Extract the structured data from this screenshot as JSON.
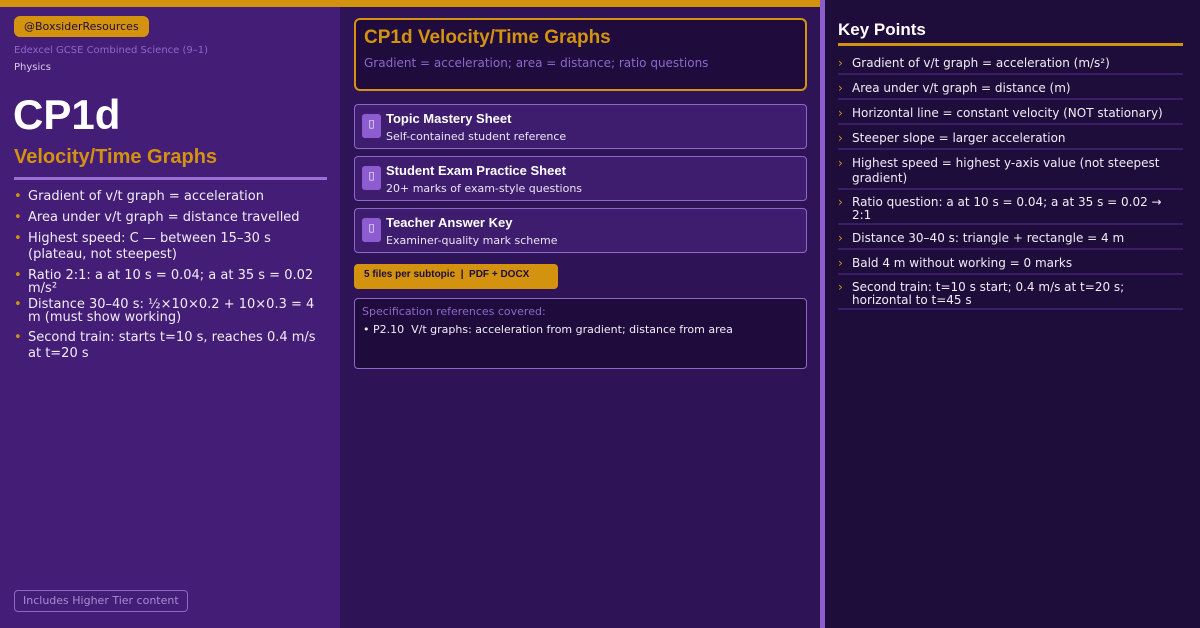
{
  "brand": {
    "handle": "@BoxsiderResources"
  },
  "course": {
    "exam_board": "Edexcel GCSE Combined Science (9–1)",
    "subject": "Physics"
  },
  "topic": {
    "code": "CP1d",
    "title": "Velocity/Time Graphs"
  },
  "summary_points": [
    "Gradient of v/t graph = acceleration",
    "Area under v/t graph = distance travelled",
    "Highest speed: C — between 15–30 s (plateau, not steepest)",
    "Ratio 2:1: a at 10 s = 0.04; a at 35 s = 0.02 m/s²",
    "Distance 30–40 s: ½×10×0.2 + 10×0.3 = 4 m (must show working)",
    "Second train: starts t=10 s, reaches 0.4 m/s at t=20 s"
  ],
  "tier_note": "Includes Higher Tier content",
  "hero": {
    "title": "CP1d Velocity/Time Graphs",
    "subtitle": "Gradient = acceleration; area = distance; ratio questions"
  },
  "files": [
    {
      "icon": "document-icon",
      "title": "Topic Mastery Sheet",
      "description": "Self-contained student reference"
    },
    {
      "icon": "document-icon",
      "title": "Student Exam Practice Sheet",
      "description": "20+ marks of exam-style questions"
    },
    {
      "icon": "document-icon",
      "title": "Teacher Answer Key",
      "description": "Examiner-quality mark scheme"
    }
  ],
  "files_badge": "5 files per subtopic  |  PDF + DOCX",
  "spec": {
    "heading": "Specification references covered:",
    "items": [
      "• P2.10  V/t graphs: acceleration from gradient; distance from area"
    ]
  },
  "key_points": {
    "title": "Key Points",
    "items": [
      "Gradient of v/t graph = acceleration (m/s²)",
      "Area under v/t graph = distance (m)",
      "Horizontal line = constant velocity (NOT stationary)",
      "Steeper slope = larger acceleration",
      "Highest speed = highest y-axis value (not steepest gradient)",
      "Ratio question: a at 10 s = 0.04; a at 35 s = 0.02 → 2:1",
      "Distance 30–40 s: triangle + rectangle = 4 m",
      "Bald 4 m without working = 0 marks",
      "Second train: t=10 s start; 0.4 m/s at t=20 s; horizontal to t=45 s"
    ]
  },
  "colors": {
    "accent": "#d4930f",
    "left_panel": "#431d76",
    "middle_panel": "#2e1456",
    "right_panel": "#1e0d3a",
    "separator": "#8a5ccc"
  }
}
